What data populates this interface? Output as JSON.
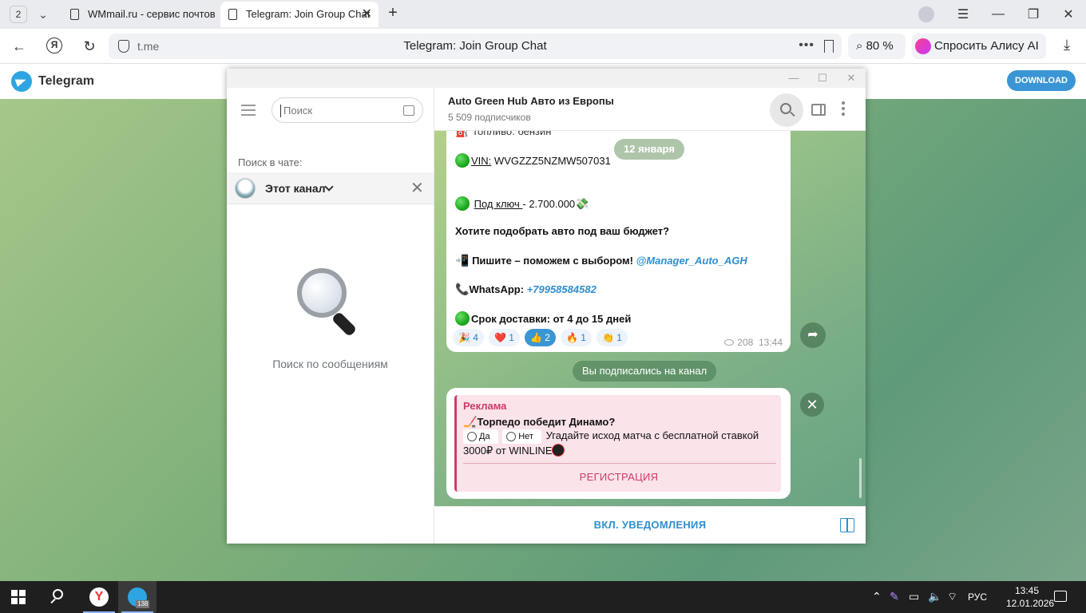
{
  "browser": {
    "tab_count": "2",
    "tabs": [
      {
        "label": "WMmail.ru - сервис почтов"
      },
      {
        "label": "Telegram: Join Group Chat"
      }
    ],
    "address_host": "t.me",
    "address_title": "Telegram: Join Group Chat",
    "zoom": "80 %",
    "alice_label": "Спросить Алису AI"
  },
  "tgweb": {
    "brand": "Telegram",
    "download_label": "DOWNLOAD"
  },
  "search_panel": {
    "placeholder": "Поиск",
    "in_chat_label": "Поиск в чате:",
    "scope_label": "Этот канал",
    "empty_text": "Поиск по сообщениям"
  },
  "chat": {
    "name": "Auto Green Hub Авто из Европы",
    "subscribers": "5 509 подписчиков",
    "date_pill": "12 января",
    "message": {
      "partial_top": "Топливо: бензин",
      "vin_label": "VIN:",
      "vin_value": "WVGZZZ5NZMW507031",
      "turnkey_label": "Под ключ ",
      "turnkey_value": "- 2.700.000",
      "question": "Хотите подобрать авто под ваш бюджет?",
      "write_text": "Пишите – поможем с выбором!",
      "manager_link": "@Manager_Auto_AGH",
      "whatsapp_label": "WhatsApp:",
      "whatsapp_number": "+79958584582",
      "delivery": "Срок доставки: от 4 до 15 дней",
      "views": "208",
      "time": "13:44"
    },
    "reactions": [
      {
        "emoji": "🎉",
        "count": "4"
      },
      {
        "emoji": "❤️",
        "count": "1"
      },
      {
        "emoji": "👍",
        "count": "2"
      },
      {
        "emoji": "🔥",
        "count": "1"
      },
      {
        "emoji": "👏",
        "count": "1"
      }
    ],
    "subscribed_notice": "Вы подписались на канал",
    "ad": {
      "tag": "Реклама",
      "question": "Торпедо победит Динамо?",
      "option_yes": "Да",
      "option_no": "Нет",
      "text": "Угадайте исход матча с бесплатной ставкой 3000₽ от WINLINE",
      "cta": "РЕГИСТРАЦИЯ"
    },
    "footer_action": "ВКЛ. УВЕДОМЛЕНИЯ"
  },
  "taskbar": {
    "telegram_badge": "138",
    "language": "РУС",
    "time": "13:45",
    "date": "12.01.2026"
  }
}
